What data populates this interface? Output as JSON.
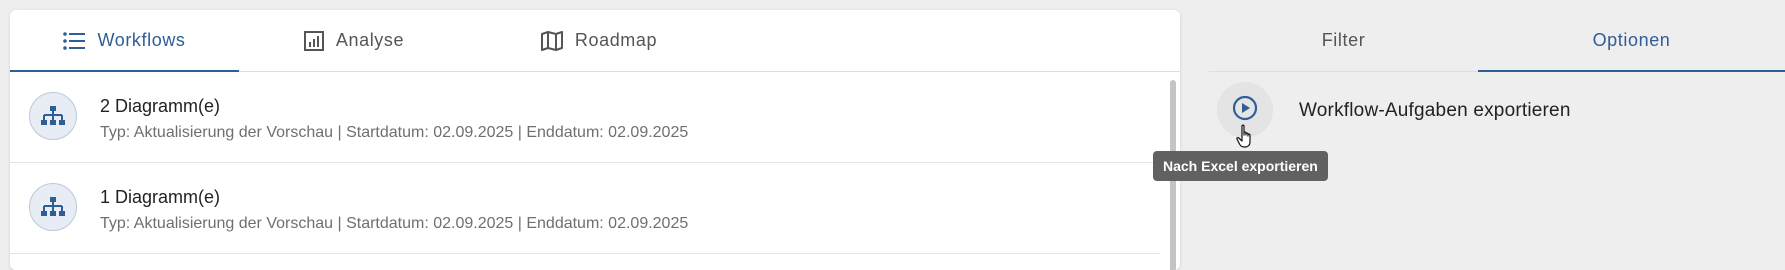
{
  "tabs": [
    {
      "label": "Workflows",
      "icon": "list-icon",
      "active": true
    },
    {
      "label": "Analyse",
      "icon": "analytics-icon",
      "active": false
    },
    {
      "label": "Roadmap",
      "icon": "map-icon",
      "active": false
    }
  ],
  "items": [
    {
      "title": "2 Diagramm(e)",
      "subtitle": "Typ: Aktualisierung der Vorschau | Startdatum: 02.09.2025 | Enddatum: 02.09.2025",
      "icon": "hierarchy-icon"
    },
    {
      "title": "1 Diagramm(e)",
      "subtitle": "Typ: Aktualisierung der Vorschau | Startdatum: 02.09.2025 | Enddatum: 02.09.2025",
      "icon": "hierarchy-icon"
    }
  ],
  "right_tabs": [
    {
      "label": "Filter",
      "active": false
    },
    {
      "label": "Optionen",
      "active": true
    }
  ],
  "options": {
    "export_label": "Workflow-Aufgaben exportieren",
    "export_icon": "play-circle-icon",
    "tooltip": "Nach Excel exportieren"
  },
  "colors": {
    "accent": "#2f5d95",
    "background": "#eeeeee",
    "tooltip_bg": "#616161"
  }
}
